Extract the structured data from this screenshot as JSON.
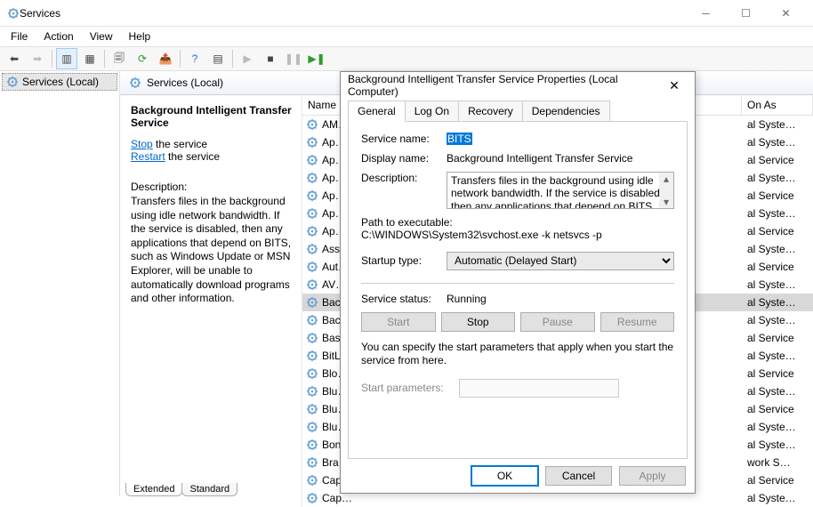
{
  "window": {
    "title": "Services"
  },
  "menu": {
    "file": "File",
    "action": "Action",
    "view": "View",
    "help": "Help"
  },
  "tree": {
    "root": "Services (Local)"
  },
  "rightHeader": "Services (Local)",
  "listHeaders": {
    "name": "Name",
    "logon": "On As"
  },
  "detail": {
    "name": "Background Intelligent Transfer Service",
    "stopText": "Stop",
    "stopSuffix": " the service",
    "restartText": "Restart",
    "restartSuffix": " the service",
    "descLabel": "Description:",
    "descText": "Transfers files in the background using idle network bandwidth. If the service is disabled, then any applications that depend on BITS, such as Windows Update or MSN Explorer, will be unable to automatically download programs and other information."
  },
  "services": [
    {
      "name": "AM…",
      "logon": "al Syste…"
    },
    {
      "name": "Ap…",
      "logon": "al Syste…"
    },
    {
      "name": "Ap…",
      "logon": "al Service"
    },
    {
      "name": "Ap…",
      "logon": "al Syste…"
    },
    {
      "name": "Ap…",
      "logon": "al Service"
    },
    {
      "name": "Ap…",
      "logon": "al Syste…"
    },
    {
      "name": "Ap…",
      "logon": "al Service"
    },
    {
      "name": "Ass…",
      "logon": "al Syste…"
    },
    {
      "name": "Aut…",
      "logon": "al Service"
    },
    {
      "name": "AV…",
      "logon": "al Syste…"
    },
    {
      "name": "Bac…",
      "logon": "al Syste…",
      "selected": true
    },
    {
      "name": "Bac…",
      "logon": "al Syste…"
    },
    {
      "name": "Bas…",
      "logon": "al Service"
    },
    {
      "name": "BitL…",
      "logon": "al Syste…"
    },
    {
      "name": "Blo…",
      "logon": "al Service"
    },
    {
      "name": "Blu…",
      "logon": "al Syste…"
    },
    {
      "name": "Blu…",
      "logon": "al Service"
    },
    {
      "name": "Blu…",
      "logon": "al Syste…"
    },
    {
      "name": "Bon…",
      "logon": "al Syste…"
    },
    {
      "name": "Bra…",
      "logon": "work S…"
    },
    {
      "name": "Cap…",
      "logon": "al Service"
    },
    {
      "name": "Cap…",
      "logon": "al Syste…"
    }
  ],
  "bottomTabs": {
    "extended": "Extended",
    "standard": "Standard"
  },
  "dialog": {
    "title": "Background Intelligent Transfer Service Properties (Local Computer)",
    "tabs": {
      "general": "General",
      "logon": "Log On",
      "recovery": "Recovery",
      "deps": "Dependencies"
    },
    "serviceNameLabel": "Service name:",
    "serviceName": "BITS",
    "displayNameLabel": "Display name:",
    "displayName": "Background Intelligent Transfer Service",
    "descriptionLabel": "Description:",
    "description": "Transfers files in the background using idle network bandwidth. If the service is disabled, then any applications that depend on BITS  such as Windows",
    "pathLabel": "Path to executable:",
    "path": "C:\\WINDOWS\\System32\\svchost.exe -k netsvcs -p",
    "startupLabel": "Startup type:",
    "startupValue": "Automatic (Delayed Start)",
    "statusLabel": "Service status:",
    "statusValue": "Running",
    "btnStart": "Start",
    "btnStop": "Stop",
    "btnPause": "Pause",
    "btnResume": "Resume",
    "note": "You can specify the start parameters that apply when you start the service from here.",
    "paramLabel": "Start parameters:",
    "ok": "OK",
    "cancel": "Cancel",
    "apply": "Apply"
  }
}
